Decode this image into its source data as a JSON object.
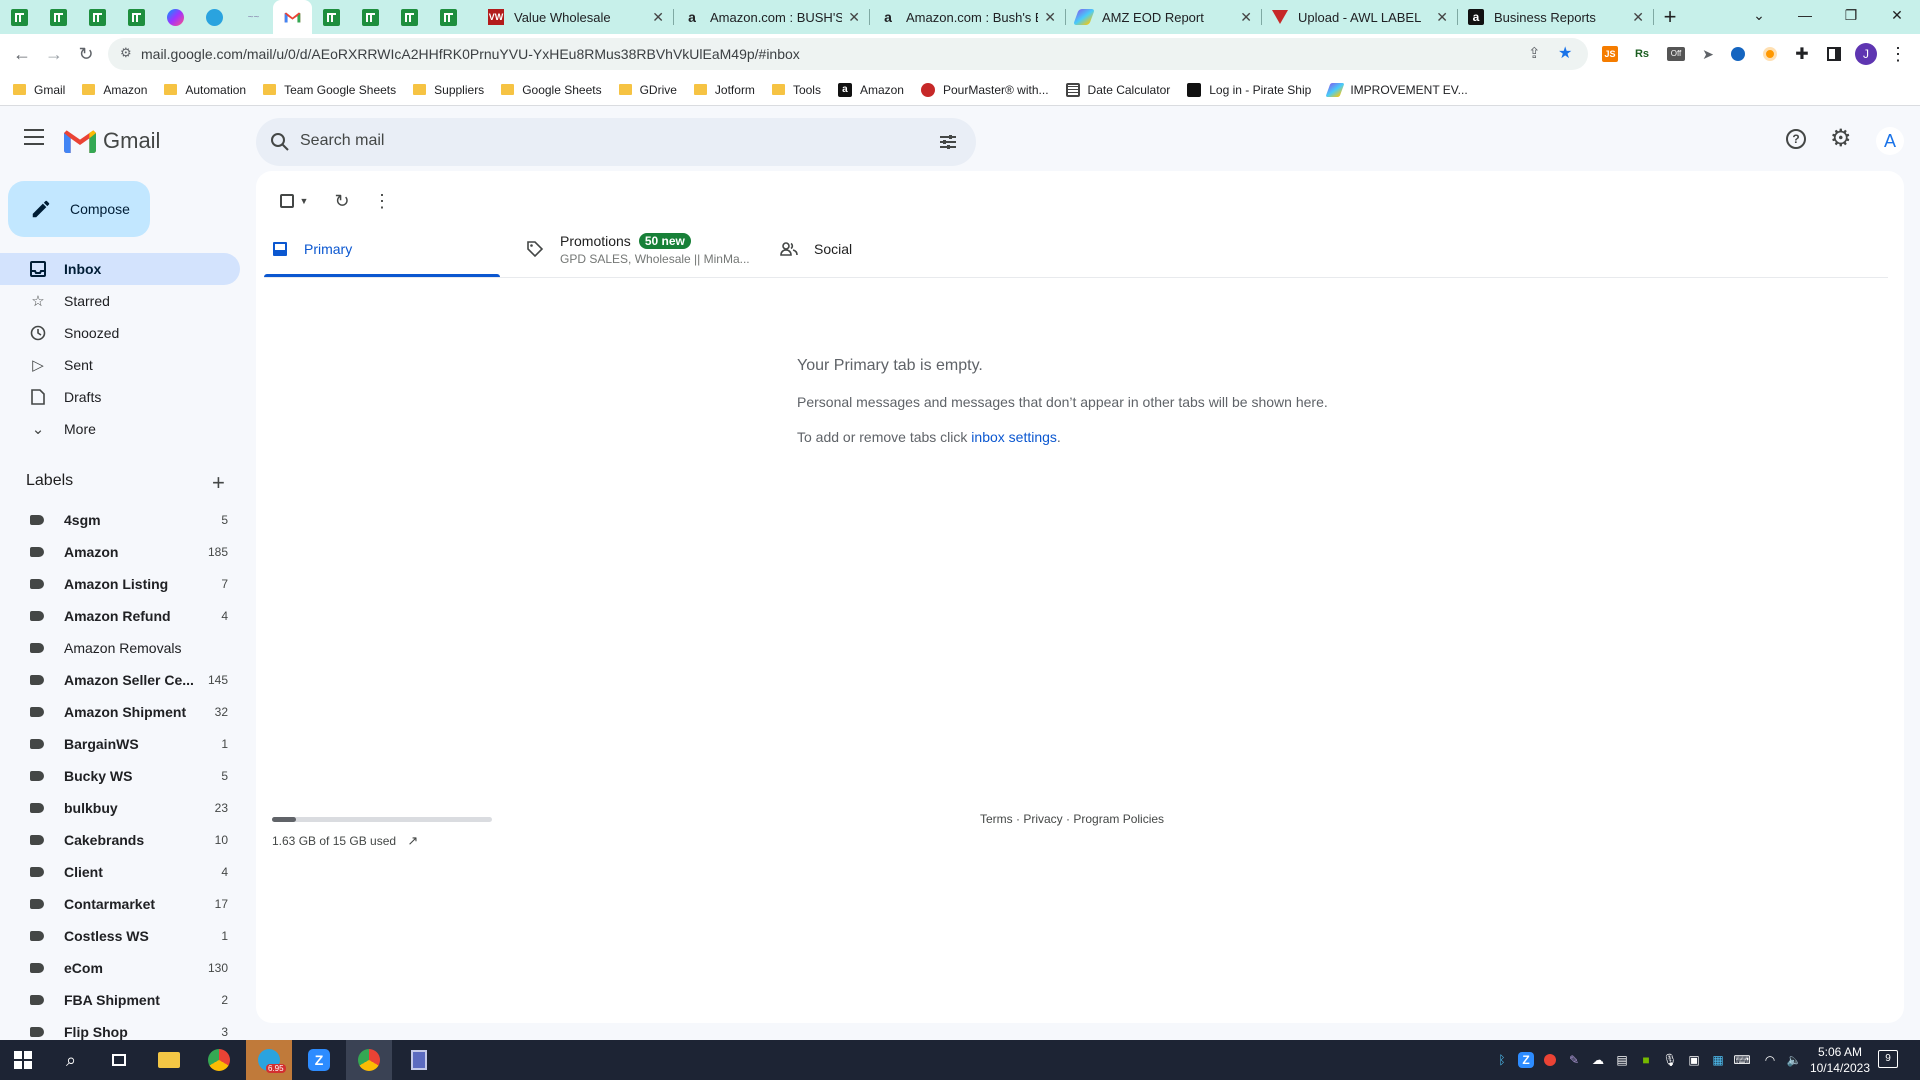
{
  "browser": {
    "tabs": [
      {
        "title": "Value Wholesale"
      },
      {
        "title": "Amazon.com : BUSH'S B"
      },
      {
        "title": "Amazon.com : Bush's Be"
      },
      {
        "title": "AMZ EOD Report"
      },
      {
        "title": "Upload - AWL LABEL"
      },
      {
        "title": "Business Reports"
      }
    ],
    "url": "mail.google.com/mail/u/0/d/AEoRXRRWIcA2HHfRK0PrnuYVU-YxHEu8RMus38RBVhVkUlEaM49p/#inbox",
    "profile_initial": "J",
    "bookmarks": [
      {
        "label": "Gmail",
        "kind": "folder"
      },
      {
        "label": "Amazon",
        "kind": "folder"
      },
      {
        "label": "Automation",
        "kind": "folder"
      },
      {
        "label": "Team Google Sheets",
        "kind": "folder"
      },
      {
        "label": "Suppliers",
        "kind": "folder"
      },
      {
        "label": "Google Sheets",
        "kind": "folder"
      },
      {
        "label": "GDrive",
        "kind": "folder"
      },
      {
        "label": "Jotform",
        "kind": "folder"
      },
      {
        "label": "Tools",
        "kind": "folder"
      },
      {
        "label": "Amazon",
        "kind": "site"
      },
      {
        "label": "PourMaster® with...",
        "kind": "site"
      },
      {
        "label": "Date Calculator",
        "kind": "site"
      },
      {
        "label": "Log in - Pirate Ship",
        "kind": "site"
      },
      {
        "label": "IMPROVEMENT EV...",
        "kind": "site"
      }
    ]
  },
  "gmail": {
    "brand": "Gmail",
    "search_placeholder": "Search mail",
    "account_initial": "A",
    "compose_label": "Compose",
    "nav": [
      {
        "label": "Inbox",
        "icon": "inbox-icon",
        "active": true
      },
      {
        "label": "Starred",
        "icon": "star-icon"
      },
      {
        "label": "Snoozed",
        "icon": "clock-icon"
      },
      {
        "label": "Sent",
        "icon": "send-icon"
      },
      {
        "label": "Drafts",
        "icon": "draft-icon"
      },
      {
        "label": "More",
        "icon": "chevron-down-icon"
      }
    ],
    "labels_heading": "Labels",
    "labels": [
      {
        "name": "4sgm",
        "count": "5",
        "bold": true
      },
      {
        "name": "Amazon",
        "count": "185",
        "bold": true
      },
      {
        "name": "Amazon Listing",
        "count": "7",
        "bold": true
      },
      {
        "name": "Amazon Refund",
        "count": "4",
        "bold": true
      },
      {
        "name": "Amazon Removals",
        "count": "",
        "bold": false
      },
      {
        "name": "Amazon Seller Ce...",
        "count": "145",
        "bold": true
      },
      {
        "name": "Amazon Shipment",
        "count": "32",
        "bold": true
      },
      {
        "name": "BargainWS",
        "count": "1",
        "bold": true
      },
      {
        "name": "Bucky WS",
        "count": "5",
        "bold": true
      },
      {
        "name": "bulkbuy",
        "count": "23",
        "bold": true
      },
      {
        "name": "Cakebrands",
        "count": "10",
        "bold": true
      },
      {
        "name": "Client",
        "count": "4",
        "bold": true
      },
      {
        "name": "Contarmarket",
        "count": "17",
        "bold": true
      },
      {
        "name": "Costless WS",
        "count": "1",
        "bold": true
      },
      {
        "name": "eCom",
        "count": "130",
        "bold": true
      },
      {
        "name": "FBA Shipment",
        "count": "2",
        "bold": true
      },
      {
        "name": "Flip Shop",
        "count": "3",
        "bold": true
      }
    ],
    "category_tabs": {
      "primary": "Primary",
      "promotions": "Promotions",
      "promotions_badge": "50 new",
      "promotions_snippet": "GPD SALES, Wholesale || MinMa...",
      "social": "Social"
    },
    "empty_state": {
      "heading": "Your Primary tab is empty.",
      "line1": "Personal messages and messages that don’t appear in other tabs will be shown here.",
      "line2_prefix": "To add or remove tabs click ",
      "line2_link": "inbox settings",
      "line2_suffix": "."
    },
    "storage": {
      "text": "1.63 GB of 15 GB used",
      "fraction": 0.109
    },
    "footer": {
      "terms": "Terms",
      "privacy": "Privacy",
      "policies": "Program Policies",
      "sep": " · "
    }
  },
  "taskbar": {
    "time": "5:06 AM",
    "date": "10/14/2023",
    "telegram_badge": "6.95",
    "notification_count": "9"
  }
}
